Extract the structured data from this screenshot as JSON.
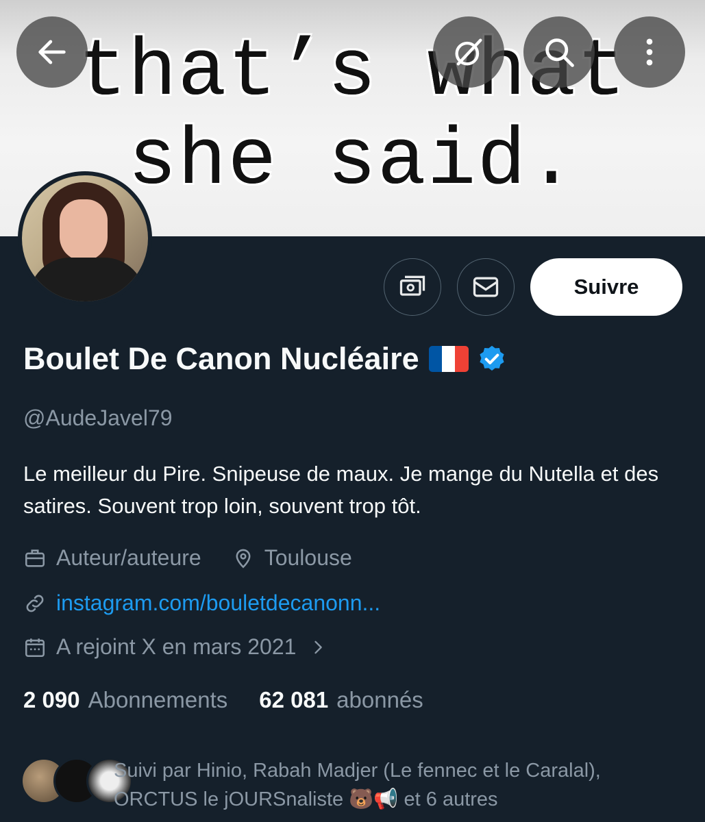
{
  "banner": {
    "line1": "that’s what",
    "line2": "she said."
  },
  "top_actions": {
    "back_icon": "arrow-left-icon",
    "grok_icon": "grok-icon",
    "search_icon": "search-icon",
    "more_icon": "more-vertical-icon"
  },
  "profile": {
    "name": "Boulet De Canon Nucléaire",
    "flag": "🇫🇷",
    "verified": true,
    "handle": "@AudeJavel79",
    "bio": "Le meilleur du Pire. Snipeuse de maux. Je mange du Nutella et des satires. Souvent trop loin, souvent trop tôt.",
    "profession": "Auteur/auteure",
    "location": "Toulouse",
    "website": "instagram.com/bouletdecanonn...",
    "joined": "A rejoint X en mars 2021",
    "following_count": "2 090",
    "following_label": "Abonnements",
    "followers_count": "62 081",
    "followers_label": "abonnés",
    "followed_by_line1": "Suivi par Hinio, Rabah Madjer (Le fennec et le Caralal),",
    "followed_by_line2": "ORCTUS le jOURSnaliste 🐻📢 et 6 autres"
  },
  "buttons": {
    "follow": "Suivre",
    "tip_icon": "money-icon",
    "message_icon": "envelope-icon"
  },
  "colors": {
    "background": "#15202b",
    "link": "#1d9bf0",
    "verified": "#1d9bf0",
    "muted": "#8b98a5"
  }
}
